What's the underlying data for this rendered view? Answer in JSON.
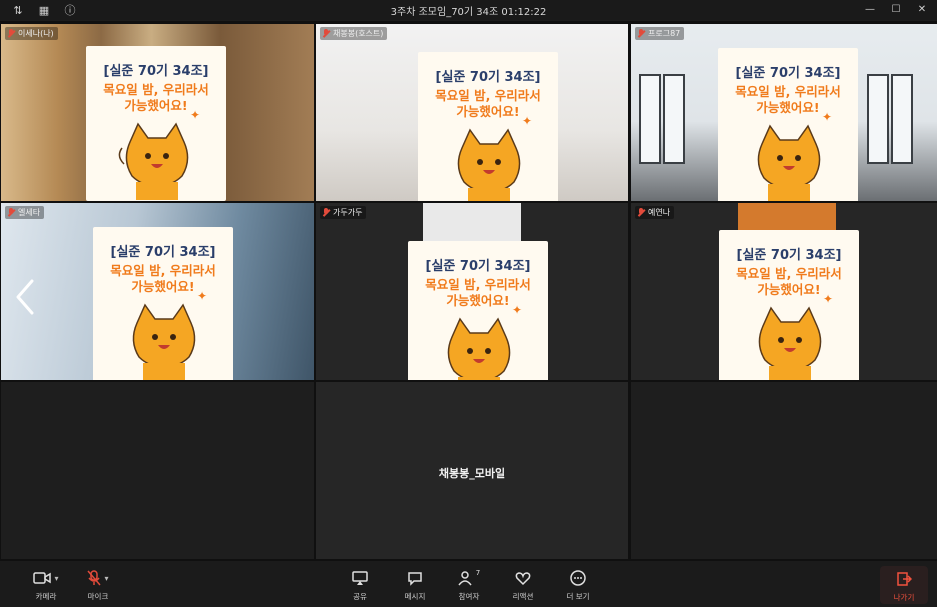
{
  "window": {
    "title": "3주차 조모임_70기 34조 01:12:22"
  },
  "participants": [
    {
      "name": "이세나(나)"
    },
    {
      "name": "채봉봉(호스트)"
    },
    {
      "name": "프로그87"
    },
    {
      "name": "엘세타"
    },
    {
      "name": "가두가두"
    },
    {
      "name": "예연나"
    }
  ],
  "card": {
    "title": "[실준 70기 34조]",
    "line1": "목요일 밤, 우리라서",
    "line2": "가능했어요!"
  },
  "audio_only": {
    "name": "채봉봉_모바일"
  },
  "toolbar": {
    "camera": "카메라",
    "mic": "마이크",
    "share": "공유",
    "chat": "메시지",
    "participants": "참여자",
    "participants_count": "7",
    "reactions": "리액션",
    "more": "더 보기",
    "leave": "나가기"
  },
  "colors": {
    "accent": "#f07b1c",
    "mute": "#e24b3b",
    "leave": "#f2523e"
  }
}
